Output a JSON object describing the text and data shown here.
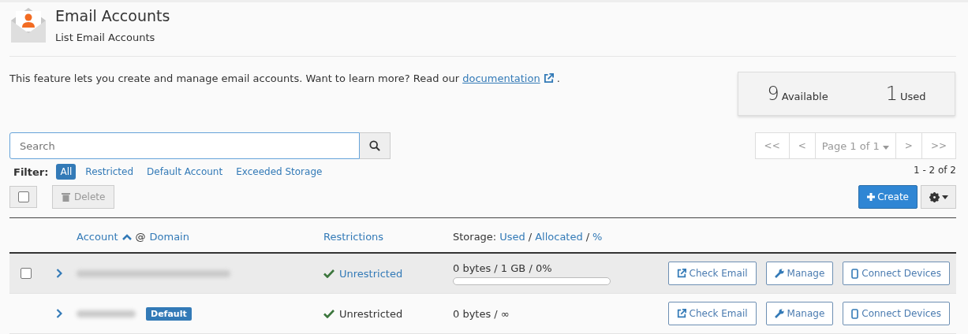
{
  "header": {
    "title": "Email Accounts",
    "subtitle": "List Email Accounts"
  },
  "intro": {
    "text": "This feature lets you create and manage email accounts. Want to learn more? Read our",
    "link": "documentation",
    "end": "."
  },
  "stats": [
    {
      "value": "9",
      "label": "Available"
    },
    {
      "value": "1",
      "label": "Used"
    }
  ],
  "search": {
    "placeholder": "Search"
  },
  "pagination": {
    "first": "<<",
    "prev": "<",
    "page": "Page 1 of 1",
    "next": ">",
    "last": ">>",
    "range": "1 - 2 of 2"
  },
  "filter": {
    "label": "Filter:",
    "options": [
      {
        "label": "All",
        "selected": true
      },
      {
        "label": "Restricted",
        "selected": false
      },
      {
        "label": "Default Account",
        "selected": false
      },
      {
        "label": "Exceeded Storage",
        "selected": false
      }
    ]
  },
  "toolbar": {
    "select_all_checked": false,
    "delete": "Delete",
    "create": "Create"
  },
  "columns": {
    "account": "Account",
    "at": "@",
    "domain": "Domain",
    "restrictions": "Restrictions",
    "storage": "Storage:",
    "used": "Used",
    "slash1": "/",
    "allocated": "Allocated",
    "slash2": "/",
    "percent": "%"
  },
  "rows": [
    {
      "account_blurred": true,
      "checked": false,
      "highlighted": true,
      "badge": null,
      "restriction": "Unrestricted",
      "restriction_link": true,
      "storage": "0 bytes / 1 GB / 0%",
      "level": 0,
      "actions": [
        "Check Email",
        "Manage",
        "Connect Devices"
      ]
    },
    {
      "account_blurred": true,
      "highlighted": false,
      "badge": "Default",
      "restriction": "Unrestricted",
      "restriction_link": false,
      "storage": "0 bytes / ∞",
      "actions": [
        "Check Email",
        "Manage",
        "Connect Devices"
      ]
    }
  ]
}
